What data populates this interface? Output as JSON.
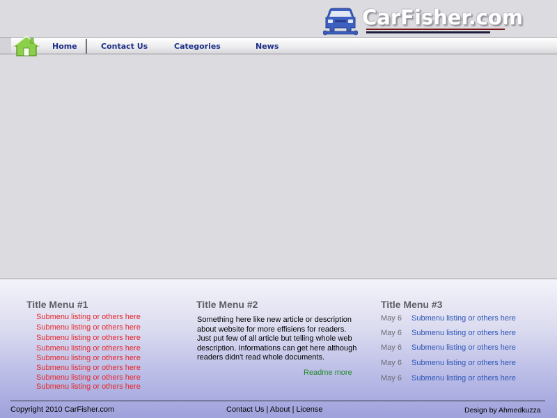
{
  "brand": {
    "logo_text": "CarFisher.com",
    "accent_color": "#1c2f86",
    "logo_line_colors": [
      "#7a1518",
      "#1c1d3a"
    ]
  },
  "nav": {
    "items": [
      {
        "label": "Home"
      },
      {
        "label": "Contact Us"
      },
      {
        "label": "Categories"
      },
      {
        "label": "News"
      }
    ]
  },
  "footer": {
    "col1": {
      "title": "Title Menu #1",
      "links": [
        "Submenu listing or others here",
        "Submenu listing or others here",
        "Submenu listing or others here",
        "Submenu listing or others here",
        "Submenu listing or others here",
        "Submenu listing or others here",
        "Submenu listing or others here",
        "Submenu listing or others here"
      ]
    },
    "col2": {
      "title": "Title Menu #2",
      "text": "Something here like new article or description about website for more effisiens for readers. Just put few of all article but telling whole web description. Informations can get here although readers didn't read whole documents.",
      "readmore": "Readme more"
    },
    "col3": {
      "title": "Title Menu #3",
      "items": [
        {
          "date": "May 6",
          "text": "Submenu listing or others here"
        },
        {
          "date": "May 6",
          "text": "Submenu listing or others here"
        },
        {
          "date": "May 6",
          "text": "Submenu listing or others here"
        },
        {
          "date": "May 6",
          "text": "Submenu listing or others here"
        },
        {
          "date": "May 6",
          "text": "Submenu listing or others here"
        }
      ]
    },
    "copyright": "Copyright 2010 CarFisher.com",
    "links": {
      "contact": "Contact Us",
      "sep1": " | ",
      "about": "About",
      "sep2": " | ",
      "license": "License"
    },
    "credit": "Design by Ahmedkuzza"
  }
}
